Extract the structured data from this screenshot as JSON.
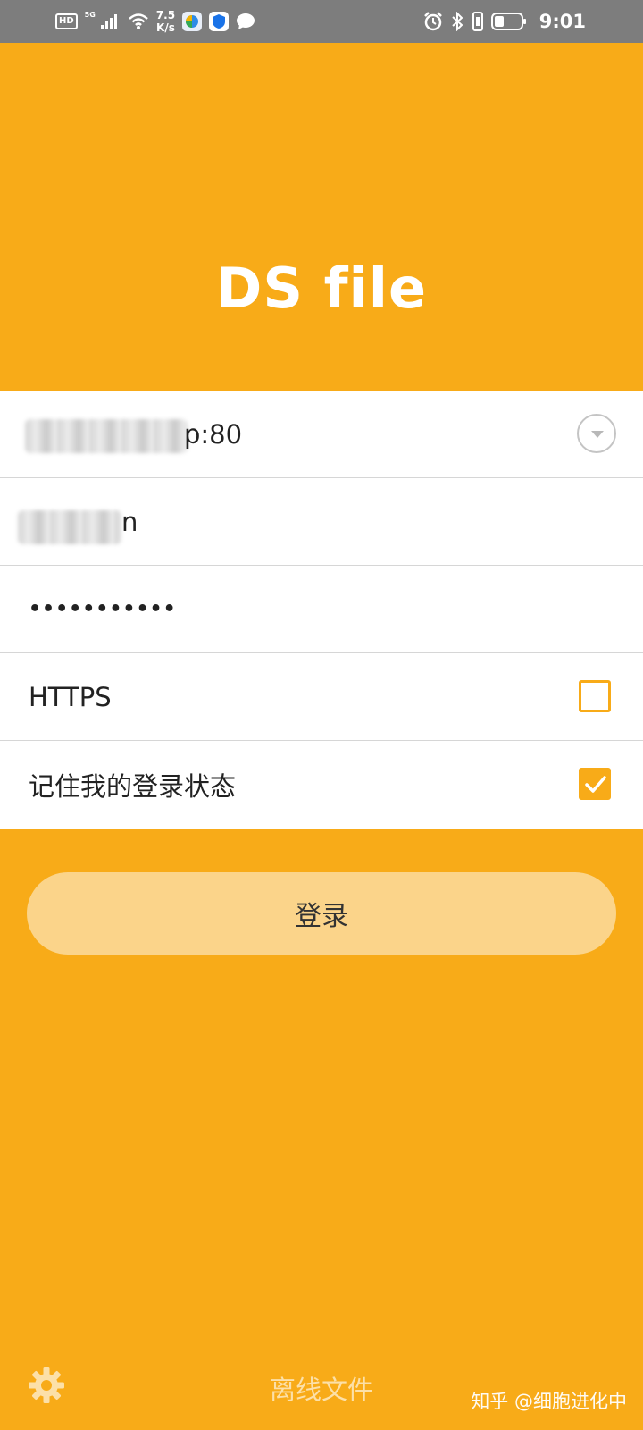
{
  "status_bar": {
    "hd": "HD",
    "network": "5G",
    "speed_value": "7.5",
    "speed_unit": "K/s",
    "time": "9:01"
  },
  "header": {
    "title": "DS file"
  },
  "form": {
    "server_suffix": "p:80",
    "account_suffix": "n",
    "password_masked": "•••••••••••",
    "https_label": "HTTPS",
    "https_checked": false,
    "remember_label": "记住我的登录状态",
    "remember_checked": true
  },
  "login_button": {
    "label": "登录"
  },
  "footer": {
    "offline_label": "离线文件",
    "watermark": "知乎 @细胞进化中"
  },
  "colors": {
    "accent": "#f8ab18",
    "button_bg": "#fbd48a",
    "status_bar": "#7d7d7d"
  }
}
